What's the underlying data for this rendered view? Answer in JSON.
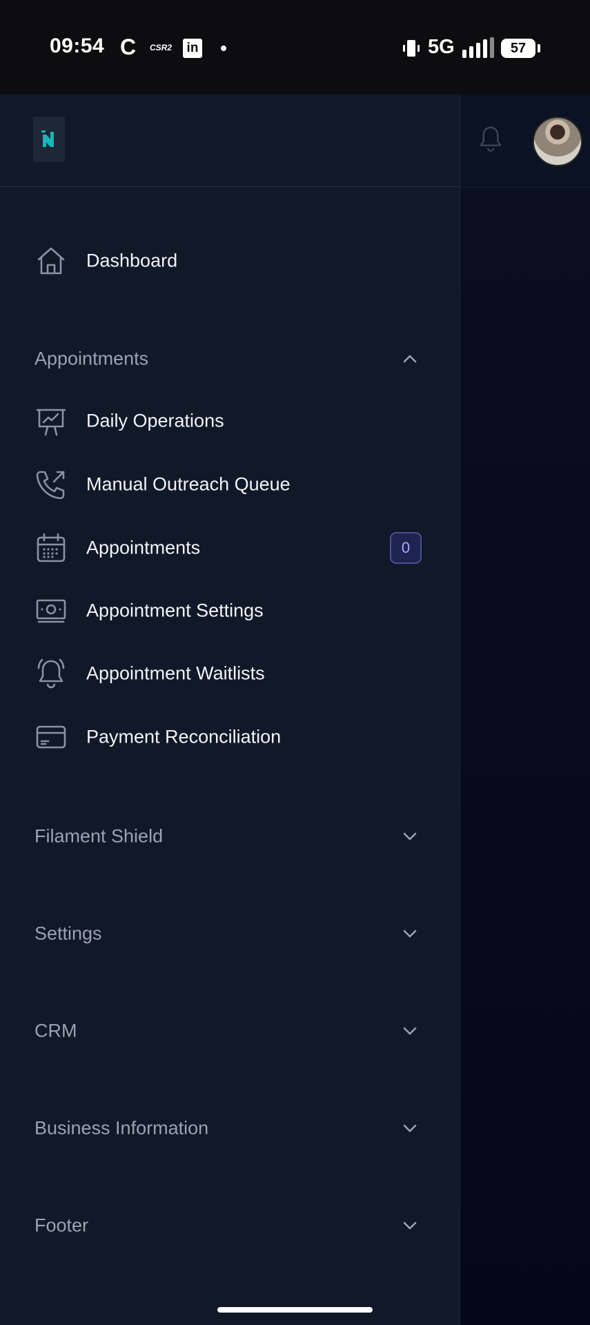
{
  "status_bar": {
    "time": "09:54",
    "app_c": "C",
    "app_csr": "CSR2",
    "app_linkedin": "in",
    "network": "5G",
    "battery": "57"
  },
  "sidebar": {
    "dashboard": "Dashboard",
    "groups": {
      "appointments": "Appointments",
      "filament_shield": "Filament Shield",
      "settings": "Settings",
      "crm": "CRM",
      "business_information": "Business Information",
      "footer": "Footer"
    },
    "appointment_items": [
      {
        "label": "Daily Operations",
        "icon": "presentation-chart-icon"
      },
      {
        "label": "Manual Outreach Queue",
        "icon": "phone-outgoing-icon"
      },
      {
        "label": "Appointments",
        "icon": "calendar-icon",
        "badge": "0"
      },
      {
        "label": "Appointment Settings",
        "icon": "banknotes-icon"
      },
      {
        "label": "Appointment Waitlists",
        "icon": "bell-alert-icon"
      },
      {
        "label": "Payment Reconciliation",
        "icon": "credit-card-icon"
      }
    ]
  },
  "colors": {
    "sidebar_bg": "#111827",
    "label": "#f1f3f7",
    "group_label": "#9aa3b2",
    "icon": "#8a93a4",
    "badge_text": "#a5acff",
    "logo_accent": "#18b6b6"
  }
}
